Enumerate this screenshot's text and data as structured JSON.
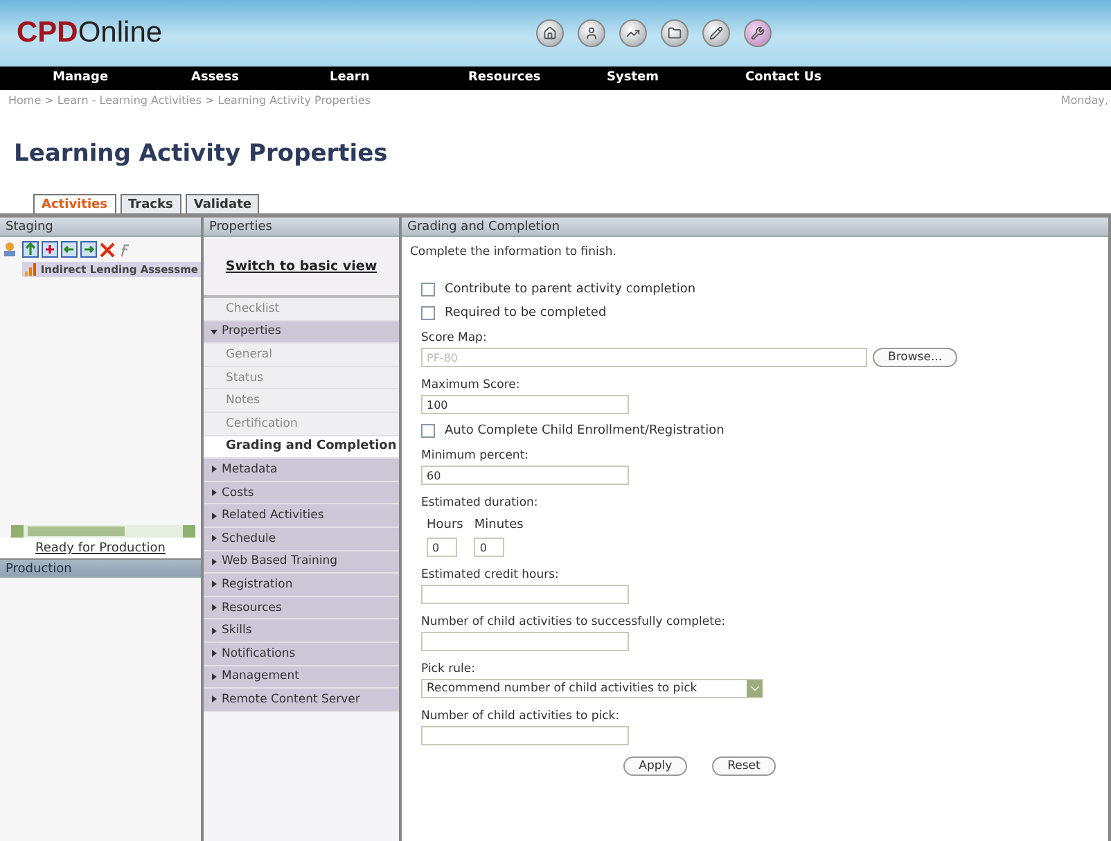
{
  "brand": {
    "bold": "CPD",
    "rest": "Online"
  },
  "nav": [
    "Manage",
    "Assess",
    "Learn",
    "Resources",
    "System",
    "Contact Us"
  ],
  "breadcrumb": "Home > Learn - Learning Activities > Learning Activity Properties",
  "date": "Monday,",
  "page_title": "Learning Activity Properties",
  "tabs": [
    {
      "label": "Activities",
      "selected": true
    },
    {
      "label": "Tracks",
      "selected": false
    },
    {
      "label": "Validate",
      "selected": false
    }
  ],
  "staging": {
    "title": "Staging",
    "items": [
      {
        "label": "Indirect Lending Assessme",
        "selected": true
      }
    ],
    "link": "Ready for Production"
  },
  "production": {
    "title": "Production"
  },
  "properties": {
    "title": "Properties",
    "switch_link": "Switch to basic view",
    "items": [
      {
        "label": "Checklist",
        "kind": "link",
        "selected": false
      },
      {
        "label": "Properties",
        "kind": "section",
        "expanded": true,
        "children": [
          {
            "label": "General",
            "selected": false
          },
          {
            "label": "Status",
            "selected": false
          },
          {
            "label": "Notes",
            "selected": false
          },
          {
            "label": "Certification",
            "selected": false
          },
          {
            "label": "Grading and Completion",
            "selected": true
          }
        ]
      },
      {
        "label": "Metadata",
        "kind": "section",
        "expanded": false
      },
      {
        "label": "Costs",
        "kind": "section",
        "expanded": false
      },
      {
        "label": "Related Activities",
        "kind": "section",
        "expanded": false
      },
      {
        "label": "Schedule",
        "kind": "section",
        "expanded": false
      },
      {
        "label": "Web Based Training",
        "kind": "section",
        "expanded": false
      },
      {
        "label": "Registration",
        "kind": "section",
        "expanded": false
      },
      {
        "label": "Resources",
        "kind": "section",
        "expanded": false
      },
      {
        "label": "Skills",
        "kind": "section",
        "expanded": false
      },
      {
        "label": "Notifications",
        "kind": "section",
        "expanded": false
      },
      {
        "label": "Management",
        "kind": "section",
        "expanded": false
      },
      {
        "label": "Remote Content Server",
        "kind": "section",
        "expanded": false
      }
    ]
  },
  "form": {
    "title": "Grading and Completion",
    "intro": "Complete the information to finish.",
    "fields": [
      {
        "kind": "checkbox",
        "label": "Contribute to parent activity completion",
        "checked": false
      },
      {
        "kind": "checkbox",
        "label": "Required to be completed",
        "checked": false
      },
      {
        "kind": "browse",
        "label": "Score Map:",
        "value": "PF-80",
        "disabled": true,
        "button": "Browse..."
      },
      {
        "kind": "text",
        "label": "Maximum Score:",
        "value": "100"
      },
      {
        "kind": "checkbox",
        "label": "Auto Complete Child Enrollment/Registration",
        "checked": false
      },
      {
        "kind": "text",
        "label": "Minimum percent:",
        "value": "60"
      },
      {
        "kind": "duration",
        "label": "Estimated duration:",
        "parts": [
          {
            "label": "Hours",
            "value": "0"
          },
          {
            "label": "Minutes",
            "value": "0"
          }
        ]
      },
      {
        "kind": "text",
        "label": "Estimated credit hours:"
      },
      {
        "kind": "text",
        "label": "Number of child activities to successfully complete:"
      },
      {
        "kind": "select",
        "label": "Pick rule:",
        "value": "Recommend number of child activities to pick"
      },
      {
        "kind": "text",
        "label": "Number of child activities to pick:"
      }
    ],
    "buttons": [
      "Apply",
      "Reset"
    ]
  }
}
